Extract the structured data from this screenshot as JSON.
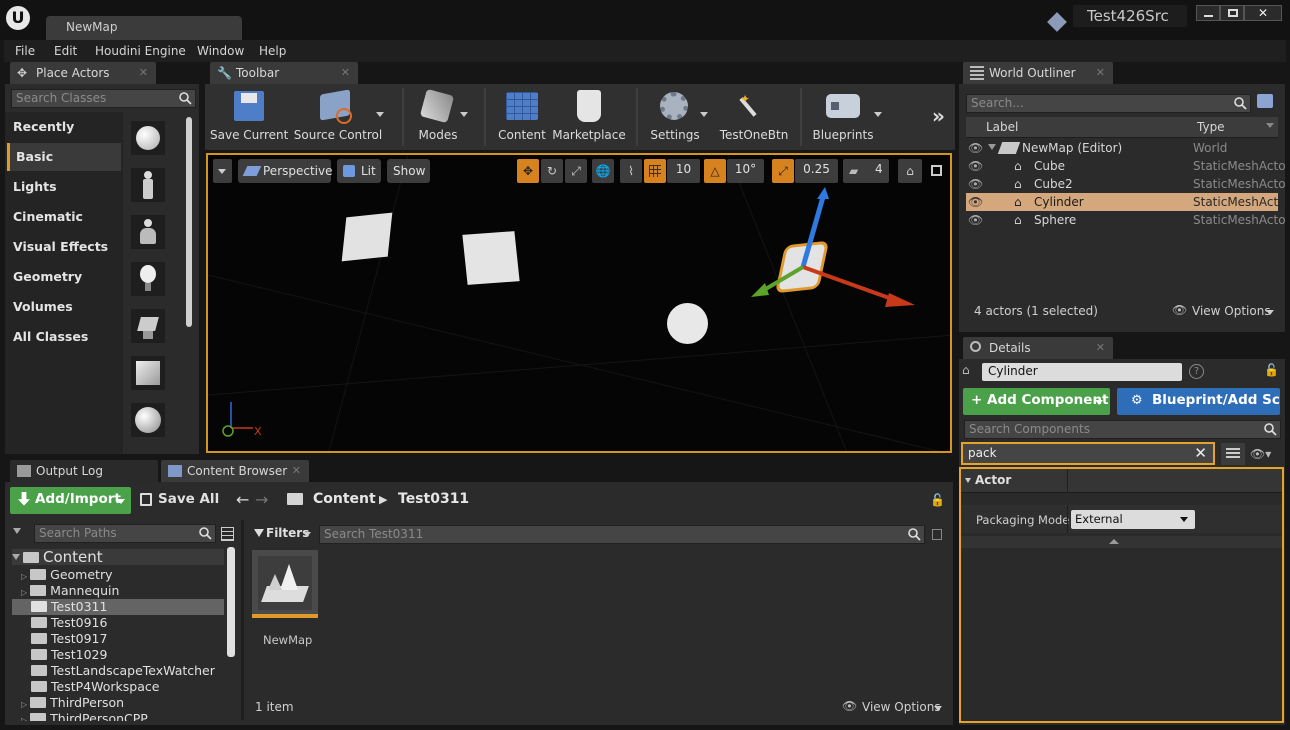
{
  "titlebar": {
    "doc_tab": "NewMap",
    "project": "Test426Src"
  },
  "menu": [
    "File",
    "Edit",
    "Houdini Engine",
    "Window",
    "Help"
  ],
  "place_actors": {
    "tab": "Place Actors",
    "search_placeholder": "Search Classes",
    "categories": [
      "Recently Placed",
      "Basic",
      "Lights",
      "Cinematic",
      "Visual Effects",
      "Geometry",
      "Volumes",
      "All Classes"
    ],
    "selected": "Basic"
  },
  "toolbar": {
    "tab": "Toolbar",
    "buttons": [
      "Save Current",
      "Source Control",
      "Modes",
      "Content",
      "Marketplace",
      "Settings",
      "TestOneBtn",
      "Blueprints"
    ]
  },
  "viewport": {
    "perspective": "Perspective",
    "lit": "Lit",
    "show": "Show",
    "grid_snap": "10",
    "rot_snap": "10°",
    "scale_snap": "0.25",
    "cam_speed": "4",
    "axis_x": "X"
  },
  "outliner": {
    "tab": "World Outliner",
    "search_placeholder": "Search...",
    "col_label": "Label",
    "col_type": "Type",
    "rows": [
      {
        "label": "NewMap (Editor)",
        "type": "World"
      },
      {
        "label": "Cube",
        "type": "StaticMeshActo"
      },
      {
        "label": "Cube2",
        "type": "StaticMeshActo"
      },
      {
        "label": "Cylinder",
        "type": "StaticMeshActo"
      },
      {
        "label": "Sphere",
        "type": "StaticMeshActo"
      }
    ],
    "status": "4 actors (1 selected)",
    "view_options": "View Options"
  },
  "details": {
    "tab": "Details",
    "name": "Cylinder",
    "add_component": "+ Add Component",
    "blueprint": "Blueprint/Add Scr",
    "search_components": "Search Components",
    "filter": "pack",
    "section": "Actor",
    "prop_label": "Packaging Mode",
    "prop_value": "External"
  },
  "bottom_tabs": {
    "output": "Output Log",
    "content": "Content Browser"
  },
  "content_browser": {
    "add_import": "Add/Import",
    "save_all": "Save All",
    "crumb_root": "Content",
    "crumb_child": "Test0311",
    "search_paths": "Search Paths",
    "filters": "Filters",
    "search_asset": "Search Test0311",
    "tree": [
      "Content",
      "Geometry",
      "Mannequin",
      "Test0311",
      "Test0916",
      "Test0917",
      "Test1029",
      "TestLandscapeTexWatcher",
      "TestP4Workspace",
      "ThirdPerson",
      "ThirdPersonCPP"
    ],
    "asset_name": "NewMap",
    "item_count": "1 item",
    "view_options": "View Options"
  }
}
